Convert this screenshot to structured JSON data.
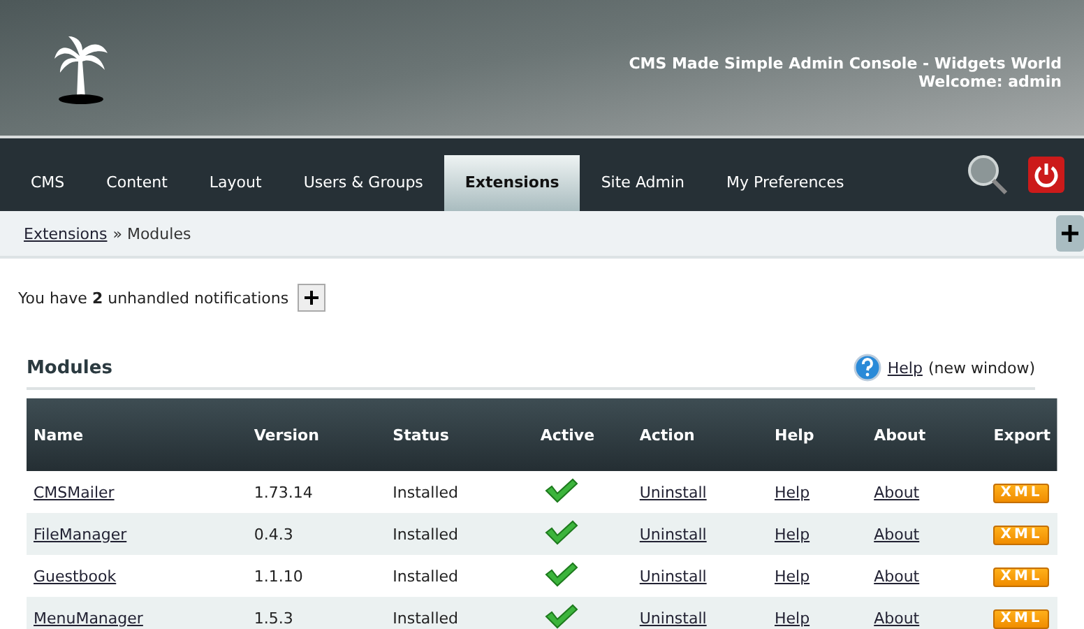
{
  "header": {
    "title": "CMS Made Simple Admin Console - Widgets World",
    "welcome": "Welcome: admin"
  },
  "nav": [
    {
      "label": "CMS",
      "selected": false
    },
    {
      "label": "Content",
      "selected": false
    },
    {
      "label": "Layout",
      "selected": false
    },
    {
      "label": "Users & Groups",
      "selected": false
    },
    {
      "label": "Extensions",
      "selected": true
    },
    {
      "label": "Site Admin",
      "selected": false
    },
    {
      "label": "My Preferences",
      "selected": false
    }
  ],
  "breadcrumb": {
    "link": "Extensions",
    "current": "» Modules"
  },
  "notification": "You have **2** unhandled notifications",
  "section": {
    "title": "Modules",
    "help_link": "Help",
    "help_note": "(new window)"
  },
  "table": {
    "columns": [
      "Name",
      "Version",
      "Status",
      "Active",
      "Action",
      "Help",
      "About",
      "Export"
    ],
    "rows": [
      {
        "name": "CMSMailer",
        "version": "1.73.14",
        "status": "Installed",
        "active": true,
        "action": "Uninstall",
        "help": "Help",
        "about": "About",
        "export": "XML"
      },
      {
        "name": "FileManager",
        "version": "0.4.3",
        "status": "Installed",
        "active": true,
        "action": "Uninstall",
        "help": "Help",
        "about": "About",
        "export": "XML"
      },
      {
        "name": "Guestbook",
        "version": "1.1.10",
        "status": "Installed",
        "active": true,
        "action": "Uninstall",
        "help": "Help",
        "about": "About",
        "export": "XML"
      },
      {
        "name": "MenuManager",
        "version": "1.5.3",
        "status": "Installed",
        "active": true,
        "action": "Uninstall",
        "help": "Help",
        "about": "About",
        "export": "XML"
      }
    ]
  }
}
